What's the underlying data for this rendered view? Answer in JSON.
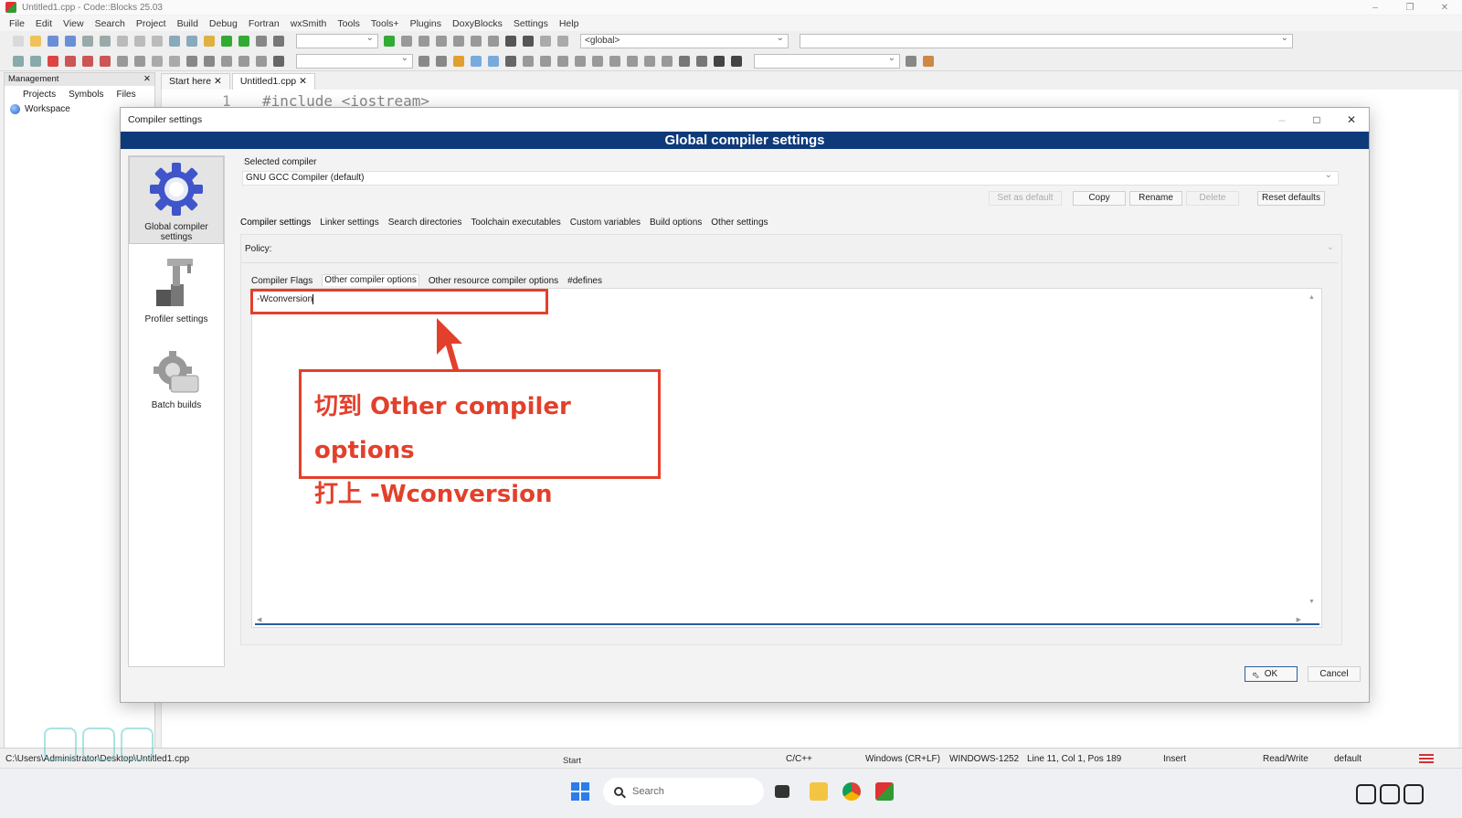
{
  "window": {
    "title": "Untitled1.cpp - Code::Blocks 25.03"
  },
  "menu": [
    "File",
    "Edit",
    "View",
    "Search",
    "Project",
    "Build",
    "Debug",
    "Fortran",
    "wxSmith",
    "Tools",
    "Tools+",
    "Plugins",
    "DoxyBlocks",
    "Settings",
    "Help"
  ],
  "toolbar": {
    "scope_combo": "<global>"
  },
  "management": {
    "title": "Management",
    "tabs": [
      "Projects",
      "Symbols",
      "Files"
    ],
    "workspace": "Workspace"
  },
  "editor": {
    "tabs": [
      "Start here",
      "Untitled1.cpp"
    ],
    "line_number": "1",
    "code_line": "#include <iostream>"
  },
  "dialog": {
    "title": "Compiler settings",
    "banner": "Global compiler settings",
    "categories": [
      "Global compiler settings",
      "Profiler settings",
      "Batch builds"
    ],
    "selected_compiler_label": "Selected compiler",
    "selected_compiler": "GNU GCC Compiler (default)",
    "buttons": {
      "set_default": "Set as default",
      "copy": "Copy",
      "rename": "Rename",
      "delete": "Delete",
      "reset": "Reset defaults"
    },
    "main_tabs": [
      "Compiler settings",
      "Linker settings",
      "Search directories",
      "Toolchain executables",
      "Custom variables",
      "Build options",
      "Other settings"
    ],
    "policy_label": "Policy:",
    "sub_tabs": [
      "Compiler Flags",
      "Other compiler options",
      "Other resource compiler options",
      "#defines"
    ],
    "other_options_value": "-Wconversion",
    "ok": "OK",
    "cancel": "Cancel"
  },
  "annotation": {
    "line1": "切到 Other compiler options",
    "line2": "打上 -Wconversion"
  },
  "statusbar": {
    "path": "C:\\Users\\Administrator\\Desktop\\Untitled1.cpp",
    "language": "C/C++",
    "eol": "Windows (CR+LF)",
    "encoding": "WINDOWS-1252",
    "position": "Line 11, Col 1, Pos 189",
    "mode": "Insert",
    "access": "Read/Write",
    "profile": "default",
    "start_label": "Start"
  },
  "taskbar": {
    "search_placeholder": "Search"
  },
  "colors": {
    "banner": "#0e3a7a",
    "annotation_red": "#e3402b",
    "start_blue": "#2b7de9"
  }
}
